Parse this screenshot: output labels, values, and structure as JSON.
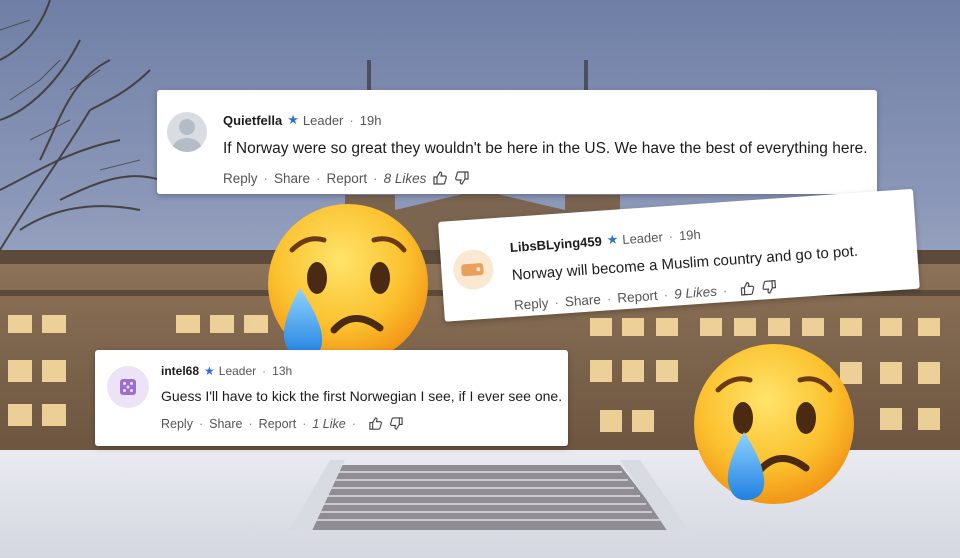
{
  "comments": [
    {
      "username": "Quietfella",
      "role": "Leader",
      "time": "19h",
      "text": "If Norway were so great they wouldn't be here in the US. We have the best of everything here.",
      "reply": "Reply",
      "share": "Share",
      "report": "Report",
      "likes": "8 Likes",
      "avatar_icon": "default-user-icon"
    },
    {
      "username": "LibsBLying459",
      "role": "Leader",
      "time": "19h",
      "text": "Norway will become a Muslim country and go to pot.",
      "reply": "Reply",
      "share": "Share",
      "report": "Report",
      "likes": "9 Likes",
      "avatar_icon": "tag-icon"
    },
    {
      "username": "intel68",
      "role": "Leader",
      "time": "13h",
      "text": "Guess I'll have to kick the first Norwegian I see, if I ever see one.",
      "reply": "Reply",
      "share": "Share",
      "report": "Report",
      "likes": "1 Like",
      "avatar_icon": "dice-icon"
    }
  ],
  "colors": {
    "star": "#2f6fd6",
    "sky": "#7f8db0",
    "building": "#9a7c5c",
    "window_light": "#f6d9a0",
    "snow": "#e6e8ee"
  },
  "decorations": [
    "crying-face-emoji",
    "crying-face-emoji"
  ]
}
